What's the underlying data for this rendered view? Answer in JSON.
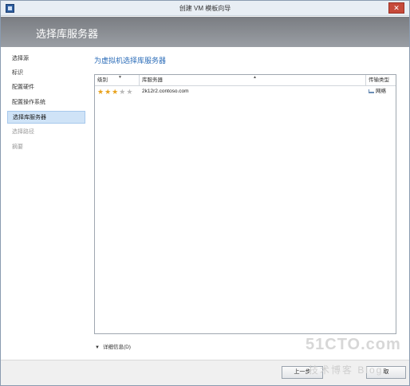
{
  "window": {
    "title": "创建 VM 模板向导",
    "close_glyph": "✕"
  },
  "header": {
    "title": "选择库服务器"
  },
  "sidebar": {
    "items": [
      {
        "label": "选择源",
        "state": "normal"
      },
      {
        "label": "标识",
        "state": "normal"
      },
      {
        "label": "配置硬件",
        "state": "normal"
      },
      {
        "label": "配置操作系统",
        "state": "normal"
      },
      {
        "label": "选择库服务器",
        "state": "active"
      },
      {
        "label": "选择路径",
        "state": "disabled"
      },
      {
        "label": "摘要",
        "state": "disabled"
      }
    ]
  },
  "main": {
    "section_title": "为虚拟机选择库服务器",
    "grid": {
      "columns": [
        "级别",
        "库服务器",
        "传输类型"
      ],
      "rows": [
        {
          "rating": 3,
          "rating_max": 5,
          "server": "2k12r2.contoso.com",
          "transfer": "网络"
        }
      ]
    },
    "details_label": "详细信息(D)"
  },
  "footer": {
    "prev_label": "上一步",
    "cancel_label": "取"
  },
  "watermark": {
    "line1": "51CTO.com",
    "line2": "技术博客 Blog"
  },
  "colors": {
    "accent": "#2b6cb8",
    "active_nav": "#cfe3f7",
    "star_on": "#e8a21c",
    "close": "#c64a3a"
  },
  "icons": {
    "app": "vm-wizard-icon",
    "rating": "star-icon",
    "transfer": "network-icon",
    "expand": "chevron-down-icon"
  }
}
